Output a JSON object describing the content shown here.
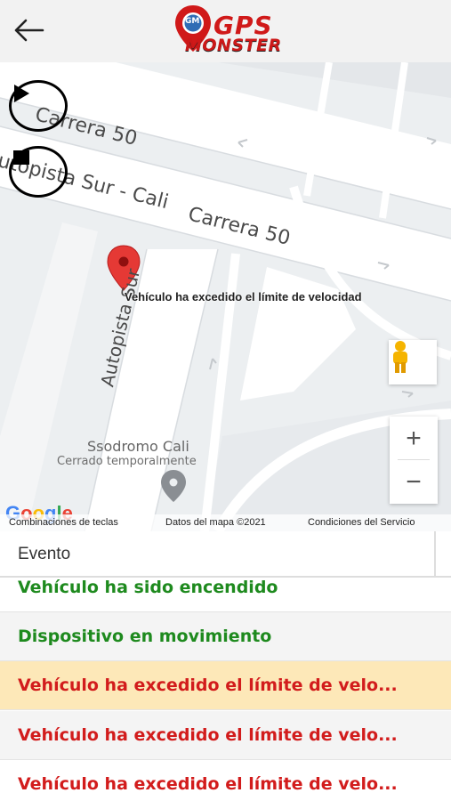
{
  "header": {
    "logo_top": "GPS",
    "logo_bottom": "MONSTER",
    "logo_badge": "GM"
  },
  "map": {
    "roads": [
      "Carrera 50",
      "Autopista Sur",
      "Carrera 50",
      "Autopista Sur"
    ],
    "road_label_upper": "Carrera 50",
    "road_label_mid": "utopista Sur - Cali",
    "road_label_lower": "Carrera 50",
    "road_label_vertical": "Autopista Sur",
    "poi_name": "Ssodromo Cali",
    "poi_status": "Cerrado temporalmente",
    "marker_label": "Vehículo ha excedido el límite de velocidad",
    "google_logo": "Google",
    "attribution": {
      "shortcuts": "Combinaciones de teclas",
      "data": "Datos del mapa ©2021",
      "terms": "Condiciones del Servicio"
    },
    "zoom_in": "+",
    "zoom_out": "−"
  },
  "table": {
    "column_header": "Evento",
    "rows": [
      {
        "text": "Vehículo ha sido encendido",
        "color": "#1e8a1e",
        "bg": "#ffffff"
      },
      {
        "text": "Dispositivo en movimiento",
        "color": "#1e8a1e",
        "bg": "#f4f4f4"
      },
      {
        "text": "Vehículo ha excedido el límite de velo...",
        "color": "#d21c1c",
        "bg": "#fde8b8"
      },
      {
        "text": "Vehículo ha excedido el límite de velo...",
        "color": "#d21c1c",
        "bg": "#f4f4f4"
      },
      {
        "text": "Vehículo ha excedido el límite de velo...",
        "color": "#d21c1c",
        "bg": "#ffffff"
      }
    ]
  },
  "colors": {
    "brand_red": "#d01919",
    "event_green": "#1e8a1e",
    "event_red": "#d21c1c",
    "selected_row": "#fde8b8"
  }
}
